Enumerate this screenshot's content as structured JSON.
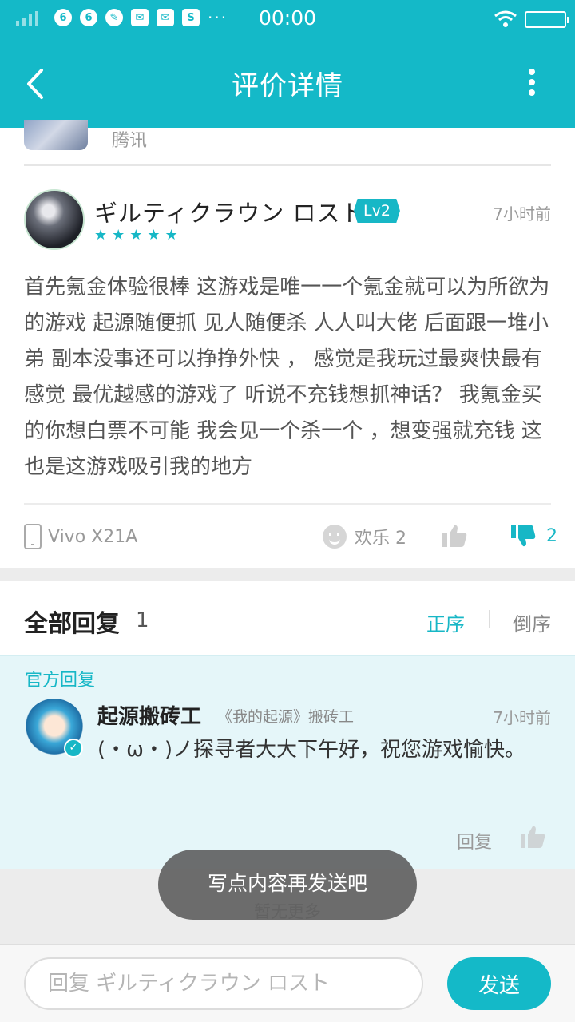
{
  "status_bar": {
    "time": "00:00"
  },
  "header": {
    "title": "评价详情"
  },
  "game": {
    "publisher": "腾讯"
  },
  "review": {
    "username": "ギルティクラウン ロスト",
    "level": "Lv2",
    "rating": 5,
    "stars": "★★★★★",
    "time": "7小时前",
    "content": "首先氪金体验很棒 这游戏是唯一一个氪金就可以为所欲为的游戏 起源随便抓 见人随便杀 人人叫大佬 后面跟一堆小弟 副本没事还可以挣挣外快 ，  感觉是我玩过最爽快最有感觉 最优越感的游戏了 听说不充钱想抓神话？ 我氪金买的你想白票不可能 我会见一个杀一个 ，想变强就充钱 这也是这游戏吸引我的地方",
    "device": "Vivo X21A",
    "happy_label": "欢乐 2",
    "dislike_count": "2"
  },
  "replies": {
    "title": "全部回复",
    "count": "1",
    "order_asc": "正序",
    "order_desc": "倒序",
    "official": {
      "label": "官方回复",
      "name": "起源搬砖工",
      "role": "《我的起源》搬砖工",
      "time": "7小时前",
      "content": "(・ω・)ノ探寻者大大下午好，祝您游戏愉快。",
      "reply_label": "回复"
    },
    "no_more": "暂无更多"
  },
  "toast": "写点内容再发送吧",
  "input": {
    "placeholder": "回复 ギルティクラウン ロスト",
    "send_label": "发送"
  },
  "colors": {
    "accent": "#14b9c8",
    "official_bg": "#e5f6f9"
  }
}
